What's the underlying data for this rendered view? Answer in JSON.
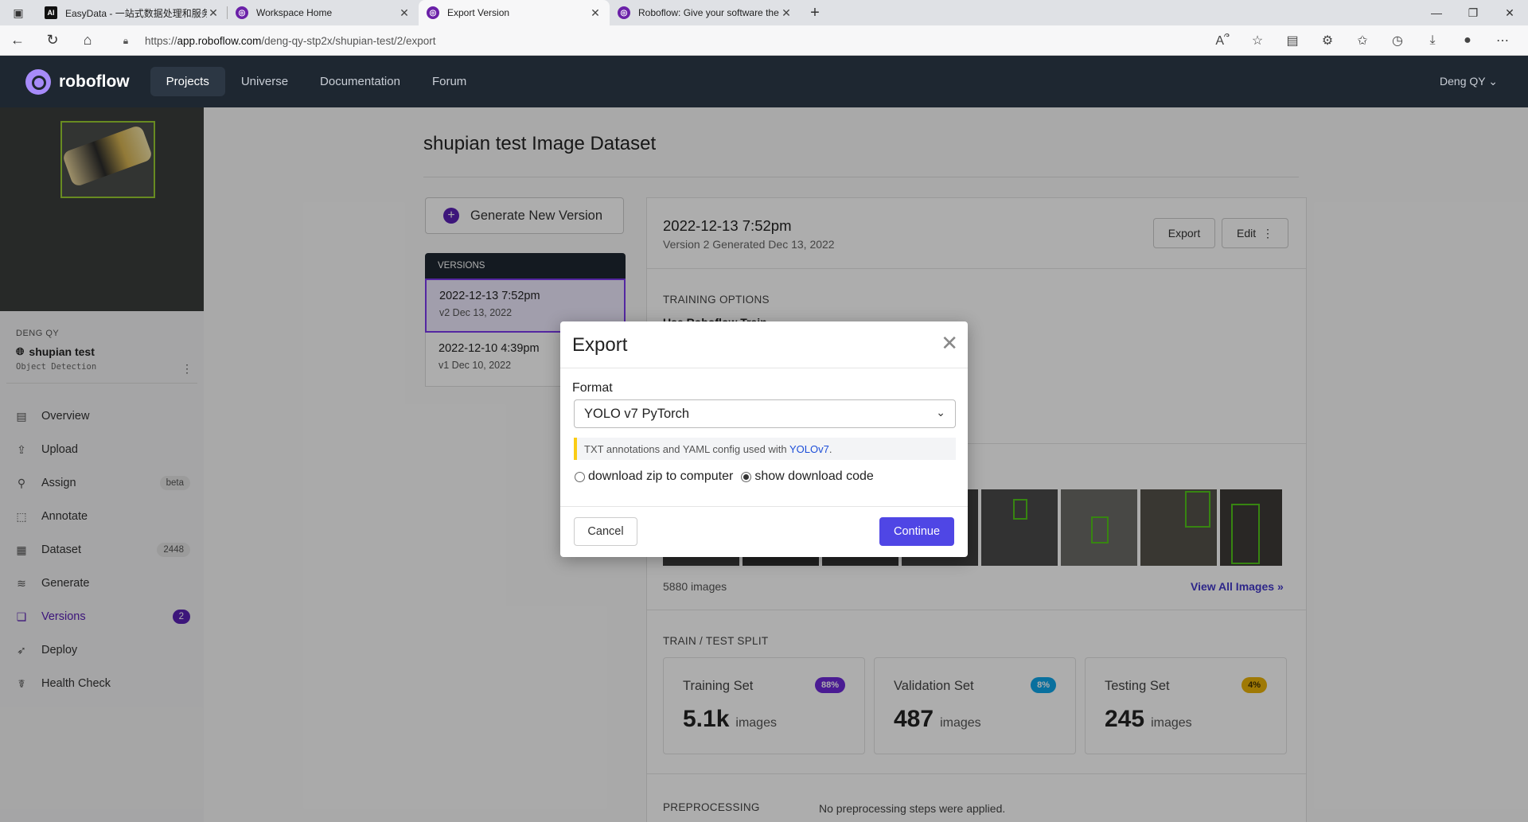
{
  "browser": {
    "tabs": [
      {
        "title": "EasyData - 一站式数据处理和服务",
        "active": false
      },
      {
        "title": "Workspace Home",
        "active": false
      },
      {
        "title": "Export Version",
        "active": true
      },
      {
        "title": "Roboflow: Give your software the",
        "active": false
      }
    ],
    "url_prefix": "https://",
    "url_host": "app.roboflow.com",
    "url_path": "/deng-qy-stp2x/shupian-test/2/export"
  },
  "header": {
    "logo": "roboflow",
    "nav": [
      "Projects",
      "Universe",
      "Documentation",
      "Forum"
    ],
    "active_nav": "Projects",
    "user": "Deng QY"
  },
  "sidebar": {
    "workspace": "DENG QY",
    "project_name": "shupian test",
    "project_type": "Object Detection",
    "items": [
      {
        "label": "Overview",
        "icon": "overview-icon",
        "badge": ""
      },
      {
        "label": "Upload",
        "icon": "upload-icon",
        "badge": ""
      },
      {
        "label": "Assign",
        "icon": "search-icon",
        "badge": "beta"
      },
      {
        "label": "Annotate",
        "icon": "annotate-icon",
        "badge": ""
      },
      {
        "label": "Dataset",
        "icon": "dataset-icon",
        "badge": "2448"
      },
      {
        "label": "Generate",
        "icon": "generate-icon",
        "badge": ""
      },
      {
        "label": "Versions",
        "icon": "versions-icon",
        "badge": "2"
      },
      {
        "label": "Deploy",
        "icon": "rocket-icon",
        "badge": ""
      },
      {
        "label": "Health Check",
        "icon": "stethoscope-icon",
        "badge": ""
      }
    ],
    "active_item": "Versions"
  },
  "main": {
    "title": "shupian test Image Dataset",
    "generate_button": "Generate New Version",
    "versions_header": "VERSIONS",
    "versions": [
      {
        "date": "2022-12-13 7:52pm",
        "meta": "v2 Dec 13, 2022"
      },
      {
        "date": "2022-12-10 4:39pm",
        "meta": "v1 Dec 10, 2022"
      }
    ],
    "detail": {
      "date": "2022-12-13 7:52pm",
      "subtitle": "Version 2 Generated Dec 13, 2022",
      "export_button": "Export",
      "edit_button": "Edit",
      "training_options_label": "TRAINING OPTIONS",
      "training_option": "Use Roboflow Train",
      "image_count": "5880 images",
      "view_all": "View All Images »",
      "split_label": "TRAIN / TEST SPLIT",
      "splits": [
        {
          "name": "Training Set",
          "pct": "88%",
          "value": "5.1k",
          "unit": "images",
          "color": "#6d28d9",
          "text": "#ffffff",
          "bg": "#ede9fe"
        },
        {
          "name": "Validation Set",
          "pct": "8%",
          "value": "487",
          "unit": "images",
          "color": "#0ea5e9",
          "text": "#ffffff",
          "bg": "#e0f2fe"
        },
        {
          "name": "Testing Set",
          "pct": "4%",
          "value": "245",
          "unit": "images",
          "color": "#eab308",
          "text": "#3f2f00",
          "bg": "#fef9c3"
        }
      ],
      "preprocessing_label": "PREPROCESSING",
      "preprocessing_value": "No preprocessing steps were applied."
    }
  },
  "modal": {
    "title": "Export",
    "format_label": "Format",
    "format_value": "YOLO v7 PyTorch",
    "hint_text": "TXT annotations and YAML config used with ",
    "hint_link": "YOLOv7",
    "hint_end": ".",
    "radio_zip": "download zip to computer",
    "radio_code": "show download code",
    "selected_radio": "show download code",
    "cancel": "Cancel",
    "continue": "Continue"
  }
}
